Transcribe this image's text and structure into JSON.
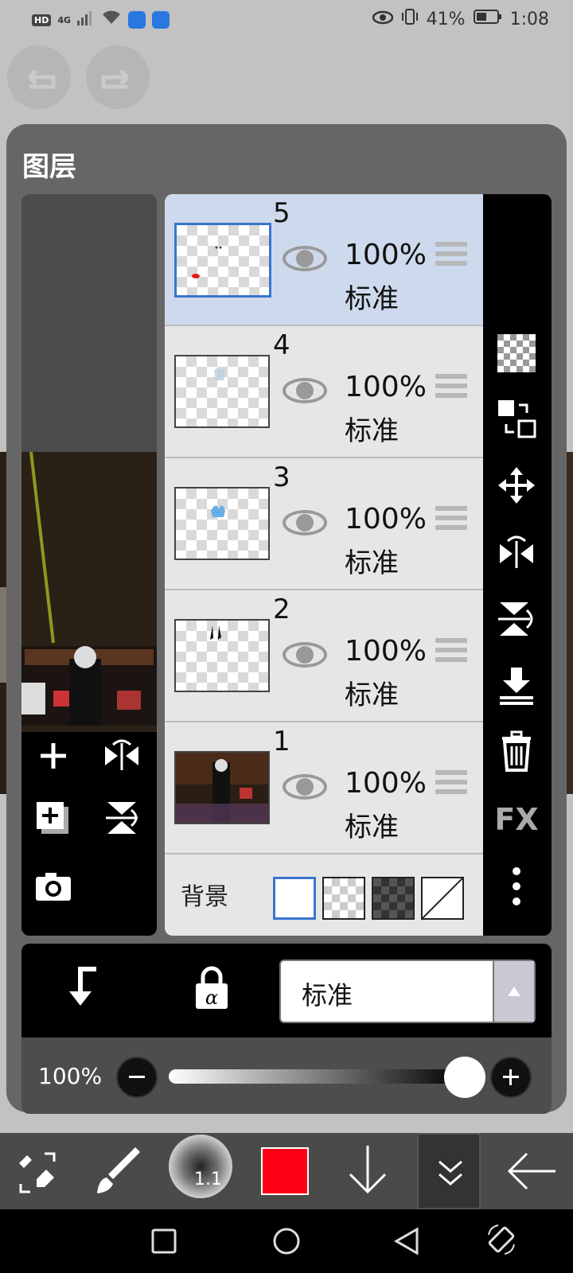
{
  "status_bar": {
    "network_badge": "HD",
    "signal_label": "4G",
    "battery_percent": "41%",
    "time": "1:08"
  },
  "top_controls": {
    "undo_icon": "undo-icon",
    "redo_icon": "redo-icon"
  },
  "panel": {
    "title": "图层",
    "layers": [
      {
        "number": "5",
        "opacity": "100%",
        "mode": "标准",
        "selected": true
      },
      {
        "number": "4",
        "opacity": "100%",
        "mode": "标准",
        "selected": false
      },
      {
        "number": "3",
        "opacity": "100%",
        "mode": "标准",
        "selected": false
      },
      {
        "number": "2",
        "opacity": "100%",
        "mode": "标准",
        "selected": false
      },
      {
        "number": "1",
        "opacity": "100%",
        "mode": "标准",
        "selected": false
      }
    ],
    "background": {
      "label": "背景",
      "options": [
        "white",
        "transparent",
        "dark-checker",
        "none"
      ],
      "selected": "white"
    },
    "right_tools": [
      "transparency-icon",
      "swap-layer-icon",
      "move-icon",
      "flip-horizontal-icon",
      "flip-vertical-icon",
      "merge-down-icon",
      "trash-icon"
    ],
    "fx_label": "FX",
    "left_tools": [
      "add-layer-icon",
      "flip-h-icon",
      "duplicate-layer-icon",
      "flip-v-icon",
      "camera-icon"
    ]
  },
  "bottom": {
    "blend_mode": "标准",
    "opacity_label": "100%",
    "opacity_value": 1.0
  },
  "toolbar": {
    "brush_size": "1.1",
    "color": "#ff0015"
  }
}
